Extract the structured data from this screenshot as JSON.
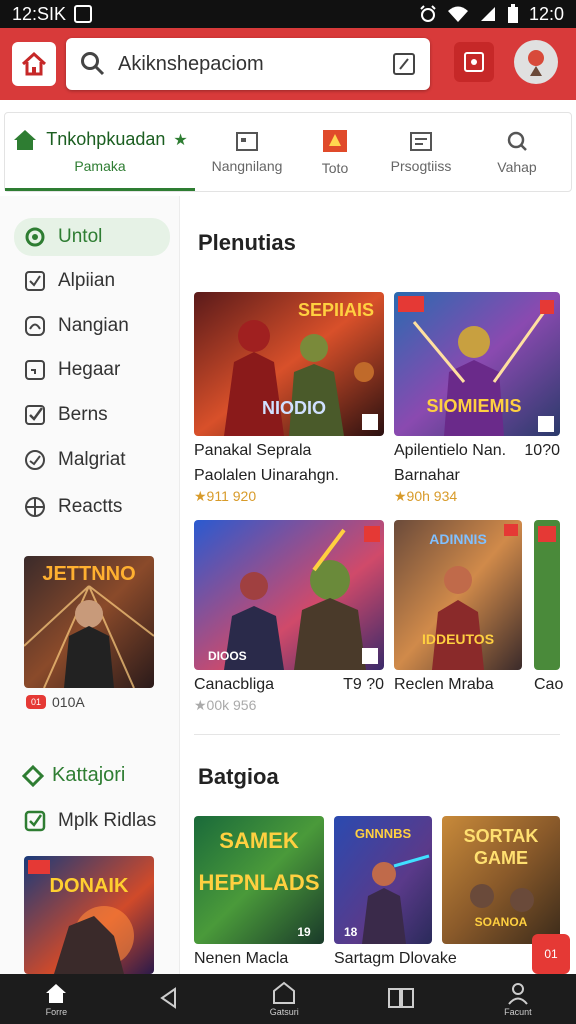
{
  "statusbar": {
    "time": "12:SIK",
    "right_time": "12:0"
  },
  "header": {
    "search_placeholder": "Akiknshepaciom"
  },
  "tabs": [
    {
      "label": "Tnkohpkuadan",
      "sublabel": "Pamaka"
    },
    {
      "label": "Nangnilang"
    },
    {
      "label": "Toto"
    },
    {
      "label": "Prsogtiiss"
    },
    {
      "label": "Vahap"
    }
  ],
  "sidebar": {
    "items": [
      {
        "label": "Untol"
      },
      {
        "label": "Alpiian"
      },
      {
        "label": "Nangian"
      },
      {
        "label": "Hegaar"
      },
      {
        "label": "Berns"
      },
      {
        "label": "Malgriat"
      },
      {
        "label": "Reactts"
      }
    ],
    "thumb1": {
      "art_text": "JETTNNO",
      "badge": "01",
      "caption": "010A"
    },
    "section2": "Kattajori",
    "item2": "Mplk Ridlas",
    "thumb2": {
      "art_text": "DONAIK"
    }
  },
  "main": {
    "section1_title": "Plenutias",
    "section2_title": "Batgioa",
    "row1": [
      {
        "art_text": "SEPIIAIS",
        "art_sub": "NIODIO",
        "title_line1": "Panakal Seprala",
        "title_line2": "Paolalen Uinarahgn.",
        "rating": "★911 920"
      },
      {
        "art_text": "SIOMIEMIS",
        "title_line1": "Apilentielo Nan.",
        "title_price": "10?0",
        "title_line2": "Barnahar",
        "rating": "★90h 934"
      }
    ],
    "row2": [
      {
        "art_sub": "DIOOS",
        "title_line1": "Canacbliga",
        "title_price": "T9 ?0",
        "rating": "★00k 956"
      },
      {
        "art_text": "ADINNIS",
        "art_sub": "IDDEUTOS",
        "title_line1": "Reclen Mraba"
      },
      {
        "title_line1": "Cao"
      }
    ],
    "row3": [
      {
        "art_text": "SAMEK",
        "art_sub": "HEPNLADS",
        "art_badge": "19",
        "title_line1": "Nenen Macla"
      },
      {
        "art_text": "GNNNBS",
        "art_badge": "18",
        "title_line1": "Sartagm Dlovake"
      },
      {
        "art_text": "SORTAK",
        "art_sub": "GAME",
        "art_badge": "SOANOA"
      }
    ]
  },
  "fab_label": "01",
  "navbar": {
    "items": [
      "Forre",
      "",
      "Gatsuri",
      "",
      "Facunt"
    ]
  },
  "colors": {
    "brand": "#d83a3a",
    "accent_green": "#2e7d32",
    "rating": "#d89b2a"
  }
}
